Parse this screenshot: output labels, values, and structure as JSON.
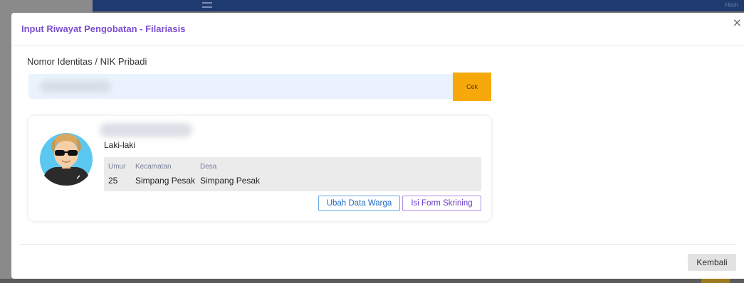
{
  "background": {
    "corner_text": "Hinh"
  },
  "modal": {
    "title": "Input Riwayat Pengobatan - Filariasis",
    "close_symbol": "×"
  },
  "nik": {
    "label": "Nomor Identitas / NIK Pribadi",
    "value": "",
    "check_label": "Cek"
  },
  "profile": {
    "name": "",
    "gender": "Laki-laki",
    "details": {
      "age_label": "Umur",
      "age_value": "25",
      "district_label": "Kecamatan",
      "district_value": "Simpang Pesak",
      "village_label": "Desa",
      "village_value": "Simpang Pesak"
    },
    "edit_button": "Ubah Data Warga",
    "screening_button": "Isi Form Skrining"
  },
  "footer": {
    "back_button": "Kembali"
  },
  "icons": {
    "close": "close-icon",
    "avatar": "avatar-icon"
  },
  "colors": {
    "title": "#7b4fd1",
    "check_button": "#f7a90c",
    "input_bg": "#eaf3fd",
    "edit_button_border": "#6aa9e6",
    "screening_button_border": "#b08ee6"
  }
}
